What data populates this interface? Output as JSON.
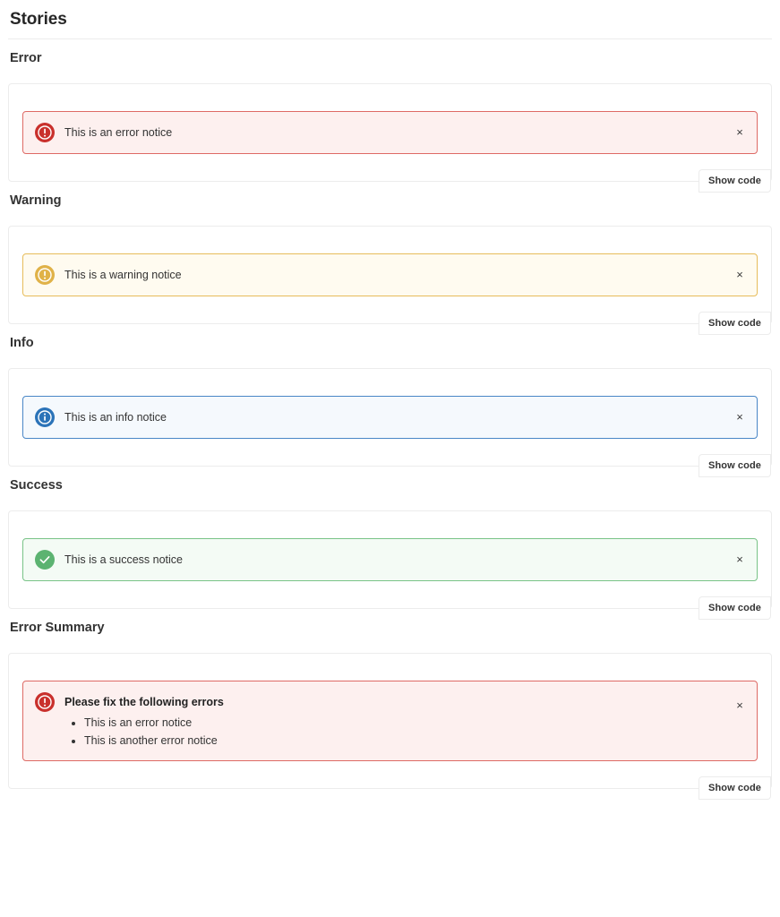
{
  "page": {
    "title": "Stories"
  },
  "show_code_label": "Show code",
  "close_icon_glyph": "×",
  "colors": {
    "error_border": "#de6a65",
    "error_bg": "#fdf0ef",
    "error_icon": "#c9302c",
    "warning_border": "#e7bc5a",
    "warning_bg": "#fffbf0",
    "warning_icon": "#e0b248",
    "info_border": "#4a87c7",
    "info_bg": "#f5f9fd",
    "info_icon": "#2b73b8",
    "success_border": "#79c387",
    "success_bg": "#f4fbf5",
    "success_icon": "#5cb371",
    "card_border": "#ececec",
    "heading_text": "#333333"
  },
  "stories": [
    {
      "heading": "Error",
      "variant": "error",
      "icon": "error-circle-icon",
      "message": "This is an error notice",
      "close_label": "Close",
      "show_code_label": "Show code"
    },
    {
      "heading": "Warning",
      "variant": "warning",
      "icon": "warning-circle-icon",
      "message": "This is a warning notice",
      "close_label": "Close",
      "show_code_label": "Show code"
    },
    {
      "heading": "Info",
      "variant": "info",
      "icon": "info-circle-icon",
      "message": "This is an info notice",
      "close_label": "Close",
      "show_code_label": "Show code"
    },
    {
      "heading": "Success",
      "variant": "success",
      "icon": "check-circle-icon",
      "message": "This is a success notice",
      "close_label": "Close",
      "show_code_label": "Show code"
    },
    {
      "heading": "Error Summary",
      "variant": "error",
      "icon": "error-circle-icon",
      "title": "Please fix the following errors",
      "items": [
        "This is an error notice",
        "This is another error notice"
      ],
      "close_label": "Close",
      "show_code_label": "Show code"
    }
  ]
}
